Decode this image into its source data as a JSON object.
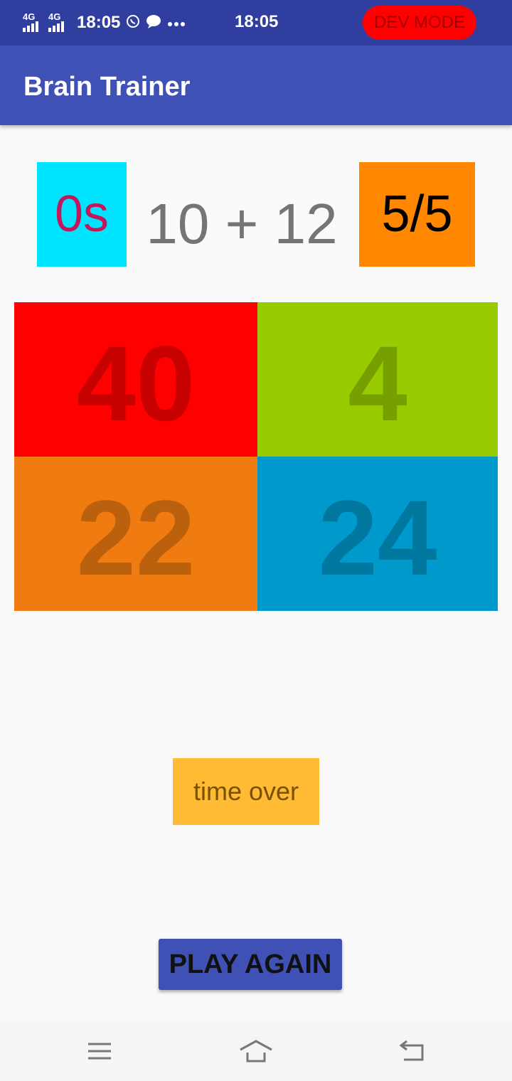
{
  "status_bar": {
    "network_1": "4G",
    "network_2": "4G",
    "time_left": "18:05",
    "time_center": "18:05",
    "dev_mode": "DEV MODE"
  },
  "app_bar": {
    "title": "Brain Trainer"
  },
  "game": {
    "timer": "0s",
    "problem": "10 + 12",
    "score": "5/5",
    "answers": [
      "40",
      "4",
      "22",
      "24"
    ],
    "result": "time over",
    "play_again": "PLAY AGAIN"
  },
  "colors": {
    "app_bar": "#3f51b5",
    "status_bar": "#303f9f",
    "timer_bg": "#00e5ff",
    "score_bg": "#ff8800",
    "answer_1_bg": "#ff0000",
    "answer_2_bg": "#99cc00",
    "answer_3_bg": "#f07b10",
    "answer_4_bg": "#0099cc",
    "result_bg": "#ffbb33"
  },
  "icons": {
    "status": [
      "signal-icon",
      "signal-icon",
      "whatsapp-icon",
      "chat-bubble-icon",
      "more-dots-icon"
    ],
    "nav": [
      "menu-icon",
      "home-icon",
      "back-icon"
    ]
  }
}
